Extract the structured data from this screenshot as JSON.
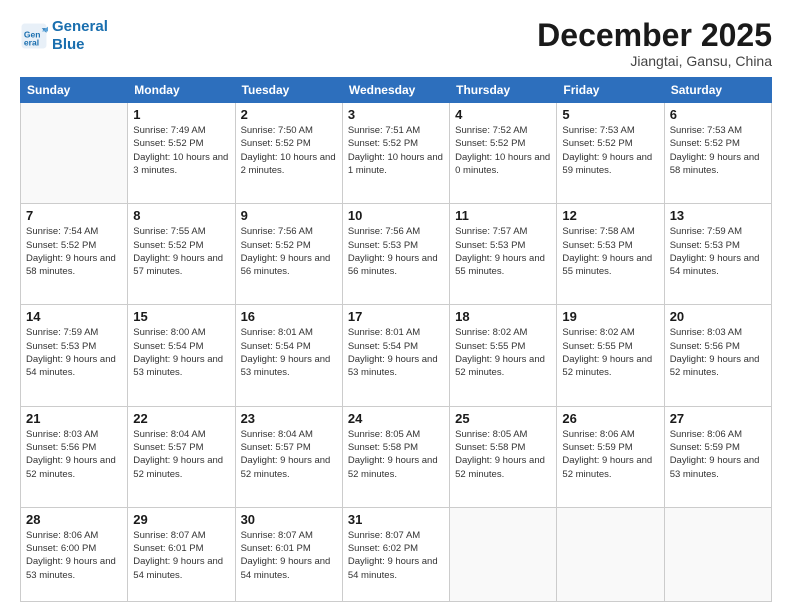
{
  "header": {
    "logo_line1": "General",
    "logo_line2": "Blue",
    "month": "December 2025",
    "location": "Jiangtai, Gansu, China"
  },
  "weekdays": [
    "Sunday",
    "Monday",
    "Tuesday",
    "Wednesday",
    "Thursday",
    "Friday",
    "Saturday"
  ],
  "weeks": [
    [
      {
        "day": "",
        "empty": true
      },
      {
        "day": "1",
        "sunrise": "7:49 AM",
        "sunset": "5:52 PM",
        "daylight": "10 hours and 3 minutes."
      },
      {
        "day": "2",
        "sunrise": "7:50 AM",
        "sunset": "5:52 PM",
        "daylight": "10 hours and 2 minutes."
      },
      {
        "day": "3",
        "sunrise": "7:51 AM",
        "sunset": "5:52 PM",
        "daylight": "10 hours and 1 minute."
      },
      {
        "day": "4",
        "sunrise": "7:52 AM",
        "sunset": "5:52 PM",
        "daylight": "10 hours and 0 minutes."
      },
      {
        "day": "5",
        "sunrise": "7:53 AM",
        "sunset": "5:52 PM",
        "daylight": "9 hours and 59 minutes."
      },
      {
        "day": "6",
        "sunrise": "7:53 AM",
        "sunset": "5:52 PM",
        "daylight": "9 hours and 58 minutes."
      }
    ],
    [
      {
        "day": "7",
        "sunrise": "7:54 AM",
        "sunset": "5:52 PM",
        "daylight": "9 hours and 58 minutes."
      },
      {
        "day": "8",
        "sunrise": "7:55 AM",
        "sunset": "5:52 PM",
        "daylight": "9 hours and 57 minutes."
      },
      {
        "day": "9",
        "sunrise": "7:56 AM",
        "sunset": "5:52 PM",
        "daylight": "9 hours and 56 minutes."
      },
      {
        "day": "10",
        "sunrise": "7:56 AM",
        "sunset": "5:53 PM",
        "daylight": "9 hours and 56 minutes."
      },
      {
        "day": "11",
        "sunrise": "7:57 AM",
        "sunset": "5:53 PM",
        "daylight": "9 hours and 55 minutes."
      },
      {
        "day": "12",
        "sunrise": "7:58 AM",
        "sunset": "5:53 PM",
        "daylight": "9 hours and 55 minutes."
      },
      {
        "day": "13",
        "sunrise": "7:59 AM",
        "sunset": "5:53 PM",
        "daylight": "9 hours and 54 minutes."
      }
    ],
    [
      {
        "day": "14",
        "sunrise": "7:59 AM",
        "sunset": "5:53 PM",
        "daylight": "9 hours and 54 minutes."
      },
      {
        "day": "15",
        "sunrise": "8:00 AM",
        "sunset": "5:54 PM",
        "daylight": "9 hours and 53 minutes."
      },
      {
        "day": "16",
        "sunrise": "8:01 AM",
        "sunset": "5:54 PM",
        "daylight": "9 hours and 53 minutes."
      },
      {
        "day": "17",
        "sunrise": "8:01 AM",
        "sunset": "5:54 PM",
        "daylight": "9 hours and 53 minutes."
      },
      {
        "day": "18",
        "sunrise": "8:02 AM",
        "sunset": "5:55 PM",
        "daylight": "9 hours and 52 minutes."
      },
      {
        "day": "19",
        "sunrise": "8:02 AM",
        "sunset": "5:55 PM",
        "daylight": "9 hours and 52 minutes."
      },
      {
        "day": "20",
        "sunrise": "8:03 AM",
        "sunset": "5:56 PM",
        "daylight": "9 hours and 52 minutes."
      }
    ],
    [
      {
        "day": "21",
        "sunrise": "8:03 AM",
        "sunset": "5:56 PM",
        "daylight": "9 hours and 52 minutes."
      },
      {
        "day": "22",
        "sunrise": "8:04 AM",
        "sunset": "5:57 PM",
        "daylight": "9 hours and 52 minutes."
      },
      {
        "day": "23",
        "sunrise": "8:04 AM",
        "sunset": "5:57 PM",
        "daylight": "9 hours and 52 minutes."
      },
      {
        "day": "24",
        "sunrise": "8:05 AM",
        "sunset": "5:58 PM",
        "daylight": "9 hours and 52 minutes."
      },
      {
        "day": "25",
        "sunrise": "8:05 AM",
        "sunset": "5:58 PM",
        "daylight": "9 hours and 52 minutes."
      },
      {
        "day": "26",
        "sunrise": "8:06 AM",
        "sunset": "5:59 PM",
        "daylight": "9 hours and 52 minutes."
      },
      {
        "day": "27",
        "sunrise": "8:06 AM",
        "sunset": "5:59 PM",
        "daylight": "9 hours and 53 minutes."
      }
    ],
    [
      {
        "day": "28",
        "sunrise": "8:06 AM",
        "sunset": "6:00 PM",
        "daylight": "9 hours and 53 minutes."
      },
      {
        "day": "29",
        "sunrise": "8:07 AM",
        "sunset": "6:01 PM",
        "daylight": "9 hours and 54 minutes."
      },
      {
        "day": "30",
        "sunrise": "8:07 AM",
        "sunset": "6:01 PM",
        "daylight": "9 hours and 54 minutes."
      },
      {
        "day": "31",
        "sunrise": "8:07 AM",
        "sunset": "6:02 PM",
        "daylight": "9 hours and 54 minutes."
      },
      {
        "day": "",
        "empty": true
      },
      {
        "day": "",
        "empty": true
      },
      {
        "day": "",
        "empty": true
      }
    ]
  ]
}
